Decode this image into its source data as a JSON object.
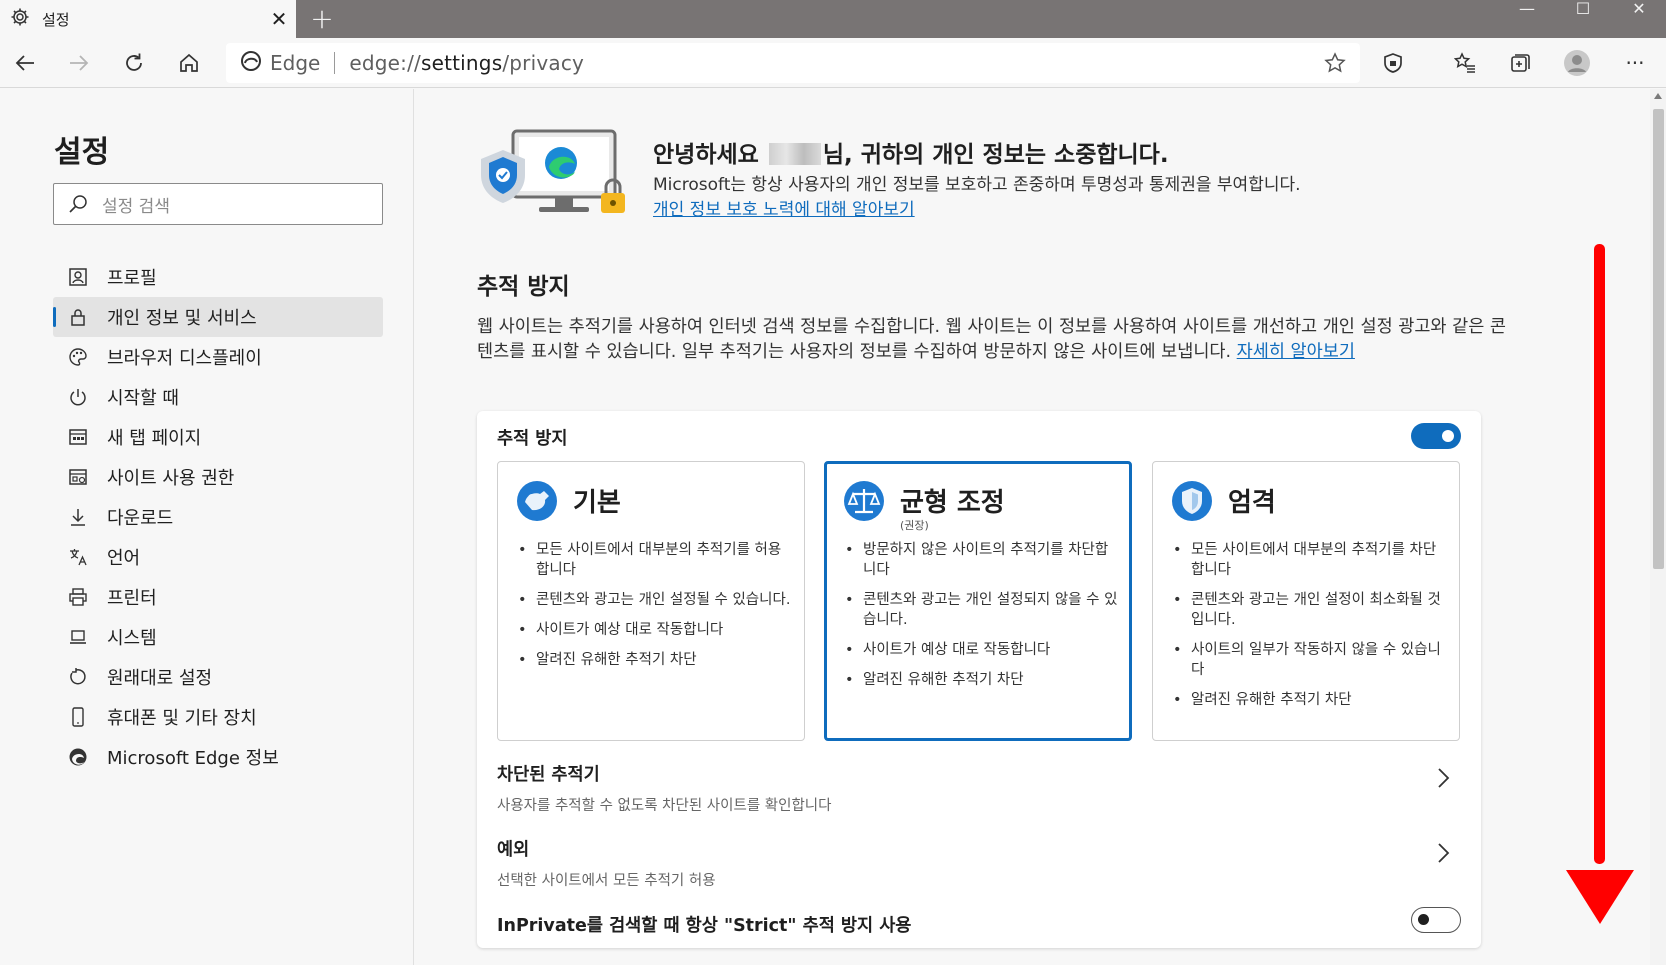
{
  "window": {
    "tab_title": "설정",
    "tab_close": "✕",
    "new_tab": "+",
    "minimize": "—",
    "maximize": "☐",
    "close": "✕"
  },
  "toolbar": {
    "address_label": "Edge",
    "url_prefix": "edge://",
    "url_main": "settings",
    "url_suffix": "/privacy",
    "more": "···"
  },
  "sidebar": {
    "title": "설정",
    "search_placeholder": "설정 검색",
    "items": [
      {
        "label": "프로필",
        "icon": "profile-icon"
      },
      {
        "label": "개인 정보 및 서비스",
        "icon": "lock-icon",
        "active": true
      },
      {
        "label": "브라우저 디스플레이",
        "icon": "palette-icon"
      },
      {
        "label": "시작할 때",
        "icon": "power-icon"
      },
      {
        "label": "새 탭 페이지",
        "icon": "newtab-page-icon"
      },
      {
        "label": "사이트 사용 권한",
        "icon": "site-permissions-icon"
      },
      {
        "label": "다운로드",
        "icon": "download-icon"
      },
      {
        "label": "언어",
        "icon": "language-icon"
      },
      {
        "label": "프린터",
        "icon": "printer-icon"
      },
      {
        "label": "시스템",
        "icon": "system-icon"
      },
      {
        "label": "원래대로 설정",
        "icon": "reset-icon"
      },
      {
        "label": "휴대폰 및 기타 장치",
        "icon": "phone-icon"
      },
      {
        "label": "Microsoft Edge 정보",
        "icon": "edge-logo-icon"
      }
    ]
  },
  "hero": {
    "title_prefix": "안녕하세요",
    "title_suffix": "님, 귀하의 개인 정보는 소중합니다.",
    "desc": "Microsoft는 항상 사용자의 개인 정보를 보호하고 존중하며 투명성과 통제권을 부여합니다.",
    "link": "개인 정보 보호 노력에 대해 알아보기"
  },
  "tracking": {
    "section_title": "추적 방지",
    "desc": "웹 사이트는 추적기를 사용하여 인터넷 검색 정보를 수집합니다. 웹 사이트는 이 정보를 사용하여 사이트를 개선하고 개인 설정 광고와 같은 콘텐츠를 표시할 수 있습니다. 일부 추적기는 사용자의 정보를 수집하여 방문하지 않은 사이트에 보냅니다.",
    "learn_more": "자세히 알아보기",
    "card_title": "추적 방지",
    "enabled": true,
    "options": [
      {
        "title": "기본",
        "subtitle": "",
        "icon": "basic-icon",
        "selected": false,
        "bullets": [
          "모든 사이트에서 대부분의 추적기를 허용합니다",
          "콘텐츠와 광고는 개인 설정될 수 있습니다.",
          "사이트가 예상 대로 작동합니다",
          "알려진 유해한 추적기 차단"
        ]
      },
      {
        "title": "균형 조정",
        "subtitle": "(권장)",
        "icon": "balance-icon",
        "selected": true,
        "bullets": [
          "방문하지 않은 사이트의 추적기를 차단합니다",
          "콘텐츠와 광고는 개인 설정되지 않을 수 있습니다.",
          "사이트가 예상 대로 작동합니다",
          "알려진 유해한 추적기 차단"
        ]
      },
      {
        "title": "엄격",
        "subtitle": "",
        "icon": "strict-shield-icon",
        "selected": false,
        "bullets": [
          "모든 사이트에서 대부분의 추적기를 차단합니다",
          "콘텐츠와 광고는 개인 설정이 최소화될 것입니다.",
          "사이트의 일부가 작동하지 않을 수 있습니다",
          "알려진 유해한 추적기 차단"
        ]
      }
    ],
    "blocked_title": "차단된 추적기",
    "blocked_desc": "사용자를 추적할 수 없도록 차단된 사이트를 확인합니다",
    "exceptions_title": "예외",
    "exceptions_desc": "선택한 사이트에서 모든 추적기 허용",
    "inprivate_label": "InPrivate를 검색할 때 항상 \"Strict\" 추적 방지 사용",
    "inprivate_enabled": false
  },
  "colors": {
    "accent": "#0f6cbd",
    "annotation_arrow": "#ff0000"
  }
}
